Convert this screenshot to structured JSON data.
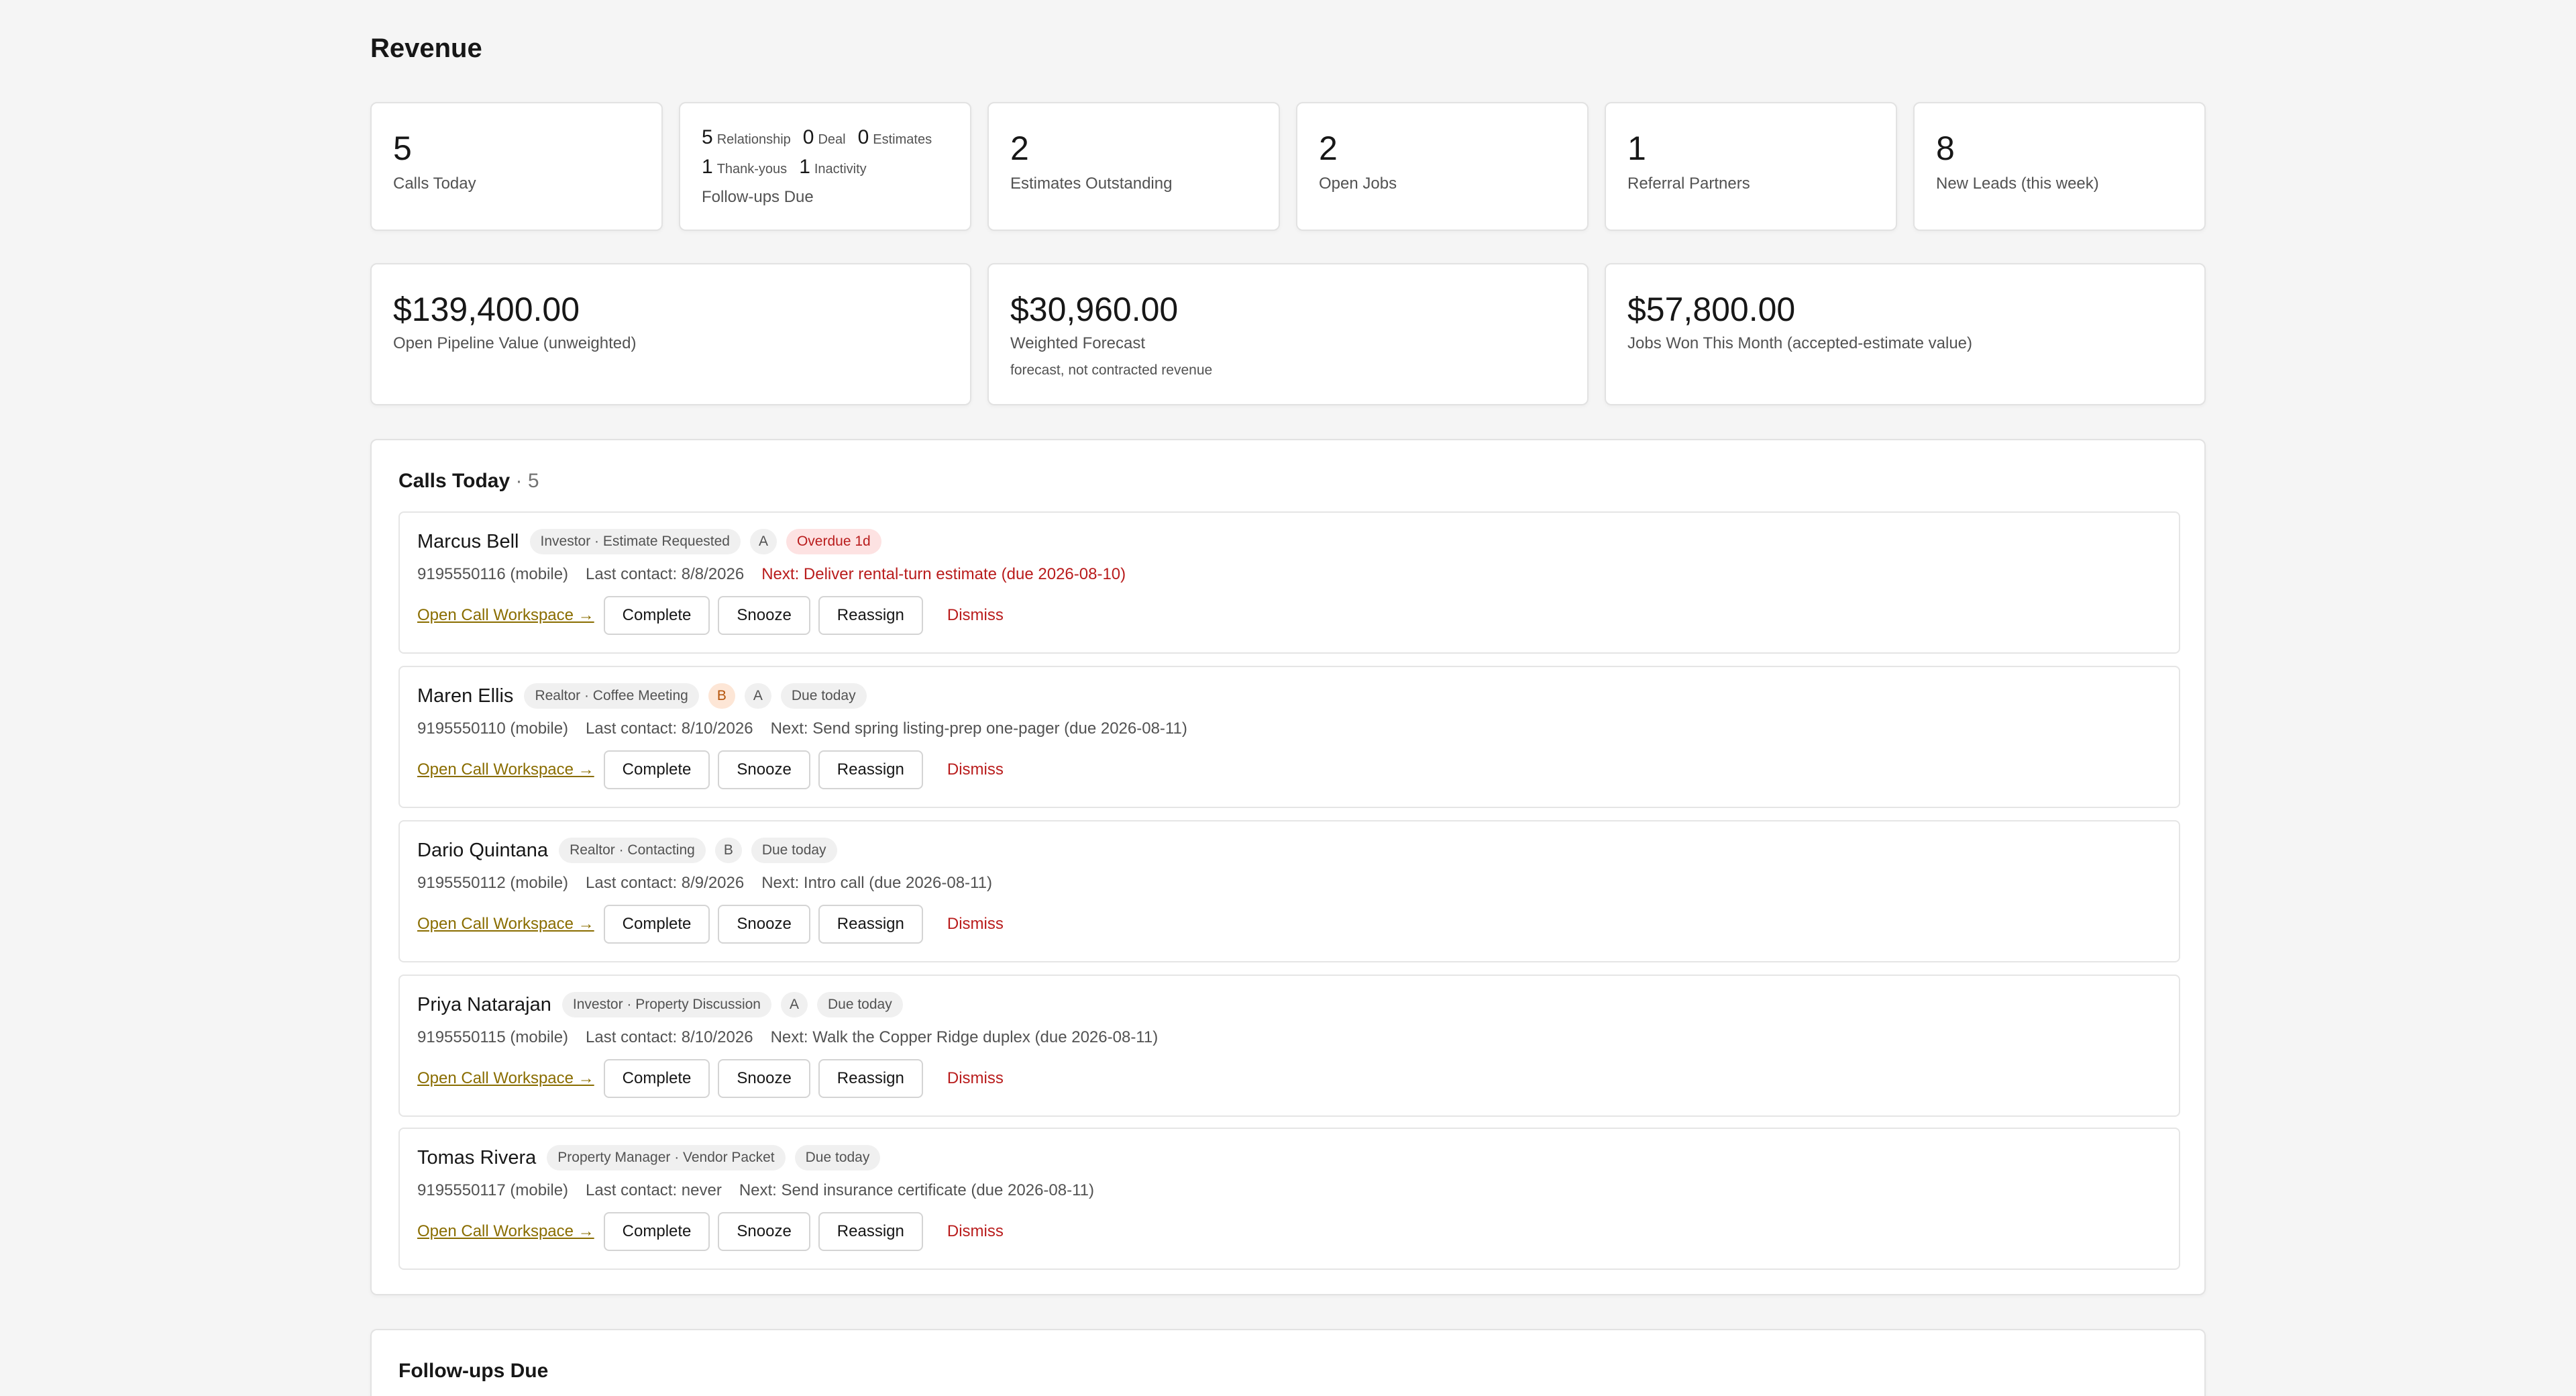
{
  "page": {
    "title": "Revenue"
  },
  "stats": [
    {
      "value": "5",
      "label": "Calls Today"
    },
    {
      "value": "2",
      "label": "Estimates Outstanding"
    },
    {
      "value": "2",
      "label": "Open Jobs"
    },
    {
      "value": "1",
      "label": "Referral Partners"
    },
    {
      "value": "8",
      "label": "New Leads (this week)"
    }
  ],
  "followups_card": {
    "label": "Follow-ups Due",
    "items": [
      {
        "count": "5",
        "label": "Relationship"
      },
      {
        "count": "0",
        "label": "Deal"
      },
      {
        "count": "0",
        "label": "Estimates"
      },
      {
        "count": "1",
        "label": "Thank-yous"
      },
      {
        "count": "1",
        "label": "Inactivity"
      }
    ]
  },
  "money": [
    {
      "value": "$139,400.00",
      "label": "Open Pipeline Value (unweighted)",
      "note": ""
    },
    {
      "value": "$30,960.00",
      "label": "Weighted Forecast",
      "note": "forecast, not contracted revenue"
    },
    {
      "value": "$57,800.00",
      "label": "Jobs Won This Month (accepted-estimate value)",
      "note": ""
    }
  ],
  "calls_section": {
    "title": "Calls Today",
    "count": "· 5",
    "actions": {
      "workspace": "Open Call Workspace →",
      "complete": "Complete",
      "snooze": "Snooze",
      "reassign": "Reassign",
      "dismiss": "Dismiss"
    },
    "items": [
      {
        "name": "Marcus Bell",
        "tag": "Investor · Estimate Requested",
        "grades": [
          "A"
        ],
        "status": "Overdue 1d",
        "phone": "9195550116 (mobile)",
        "last_contact": "Last contact: 8/8/2026",
        "next": "Next: Deliver rental-turn estimate (due 2026-08-10)"
      },
      {
        "name": "Maren Ellis",
        "tag": "Realtor · Coffee Meeting",
        "grades": [
          "B",
          "A"
        ],
        "status": "Due today",
        "phone": "9195550110 (mobile)",
        "last_contact": "Last contact: 8/10/2026",
        "next": "Next: Send spring listing-prep one-pager (due 2026-08-11)"
      },
      {
        "name": "Dario Quintana",
        "tag": "Realtor · Contacting",
        "grades": [
          "B"
        ],
        "status": "Due today",
        "phone": "9195550112 (mobile)",
        "last_contact": "Last contact: 8/9/2026",
        "next": "Next: Intro call (due 2026-08-11)"
      },
      {
        "name": "Priya Natarajan",
        "tag": "Investor · Property Discussion",
        "grades": [
          "A"
        ],
        "status": "Due today",
        "phone": "9195550115 (mobile)",
        "last_contact": "Last contact: 8/10/2026",
        "next": "Next: Walk the Copper Ridge duplex (due 2026-08-11)"
      },
      {
        "name": "Tomas Rivera",
        "tag": "Property Manager · Vendor Packet",
        "grades": [],
        "status": "Due today",
        "phone": "9195550117 (mobile)",
        "last_contact": "Last contact: never",
        "next": "Next: Send insurance certificate (due 2026-08-11)"
      }
    ]
  },
  "followups_section": {
    "title": "Follow-ups Due"
  },
  "colors": {
    "background": "#f5f5f5",
    "card": "#ffffff",
    "overdue": "#b91c1c",
    "link": "#8a6d00",
    "grade_b": "#b45309"
  }
}
